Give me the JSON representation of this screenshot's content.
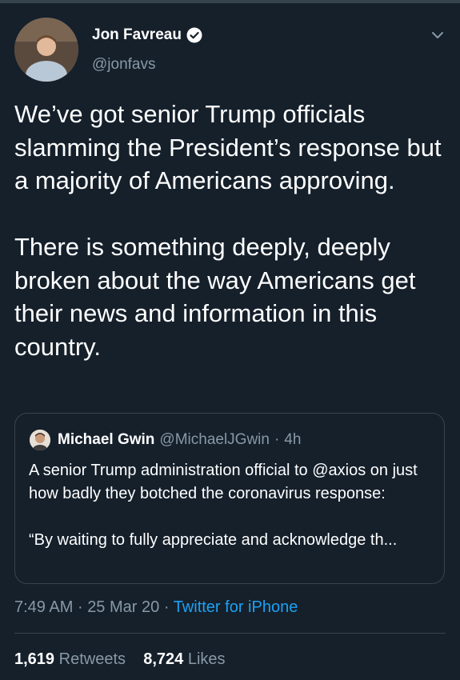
{
  "tweet": {
    "author_name": "Jon Favreau",
    "author_handle": "@jonfavs",
    "text": "We’ve got senior Trump officials slamming the President’s response but a majority of Americans approving.\n\nThere is something deeply, deeply broken about the way Americans get their news and information in this country.",
    "time": "7:49 AM",
    "date": "25 Mar 20",
    "separator": "·",
    "source": "Twitter for iPhone",
    "retweets_count": "1,619",
    "retweets_label": "Retweets",
    "likes_count": "8,724",
    "likes_label": "Likes"
  },
  "quoted": {
    "author_name": "Michael Gwin",
    "author_handle": "@MichaelJGwin",
    "separator": "·",
    "age": "4h",
    "text": "A senior Trump administration official to @axios on just how badly they botched the coronavirus response:\n\n“By waiting to fully appreciate and acknowledge th..."
  },
  "icons": [
    "avatar",
    "verified-badge-icon",
    "chevron-down-icon"
  ],
  "colors": {
    "background": "#15202b",
    "muted": "#8899a6",
    "link": "#1da1f2",
    "border": "#38444d"
  }
}
